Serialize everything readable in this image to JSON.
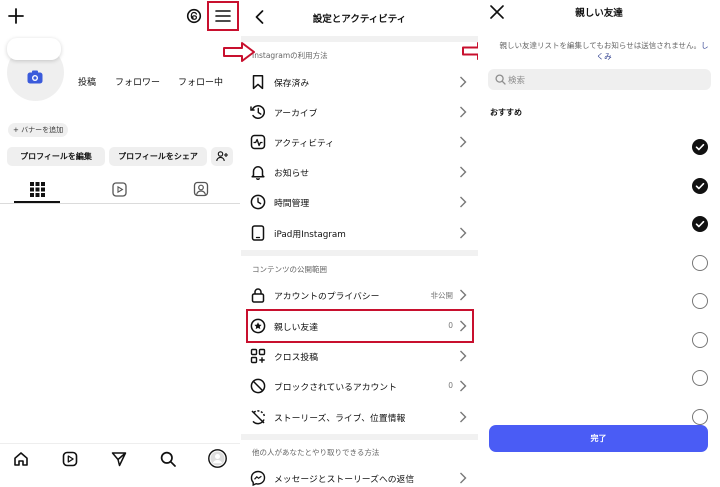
{
  "profile": {
    "stats": [
      {
        "label": "投稿"
      },
      {
        "label": "フォロワー"
      },
      {
        "label": "フォロー中"
      }
    ],
    "banner_chip": "+ バナーを追加",
    "edit_button": "プロフィールを編集",
    "share_button": "プロフィールをシェア"
  },
  "settings": {
    "title": "設定とアクティビティ",
    "sections": [
      {
        "label": "Instagramの利用方法",
        "items": [
          {
            "label": "保存済み",
            "icon": "bookmark-icon"
          },
          {
            "label": "アーカイブ",
            "icon": "archive-icon"
          },
          {
            "label": "アクティビティ",
            "icon": "activity-icon"
          },
          {
            "label": "お知らせ",
            "icon": "bell-icon"
          },
          {
            "label": "時間管理",
            "icon": "clock-icon"
          },
          {
            "label": "iPad用Instagram",
            "icon": "tablet-icon"
          }
        ]
      },
      {
        "label": "コンテンツの公開範囲",
        "items": [
          {
            "label": "アカウントのプライバシー",
            "icon": "lock-icon",
            "value": "非公開"
          },
          {
            "label": "親しい友達",
            "icon": "star-icon",
            "value": "0"
          },
          {
            "label": "クロス投稿",
            "icon": "grid-plus-icon"
          },
          {
            "label": "ブロックされているアカウント",
            "icon": "block-icon",
            "value": "0"
          },
          {
            "label": "ストーリーズ、ライブ、位置情報",
            "icon": "story-off-icon"
          }
        ]
      },
      {
        "label": "他の人があなたとやり取りできる方法",
        "items": [
          {
            "label": "メッセージとストーリーズへの返信",
            "icon": "messenger-icon"
          }
        ]
      }
    ]
  },
  "close_friends": {
    "title": "親しい友達",
    "description": "親しい友達リストを編集してもお知らせは送信されません。",
    "learn_more": "しくみ",
    "search_placeholder": "検索",
    "recommended_label": "おすすめ",
    "checkboxes": [
      true,
      true,
      true,
      false,
      false,
      false,
      false,
      false
    ],
    "done_button": "完了"
  },
  "colors": {
    "annotation_red": "#c8102e",
    "primary_blue": "#4a5cf5",
    "camera_blue": "#3b5bdb"
  }
}
